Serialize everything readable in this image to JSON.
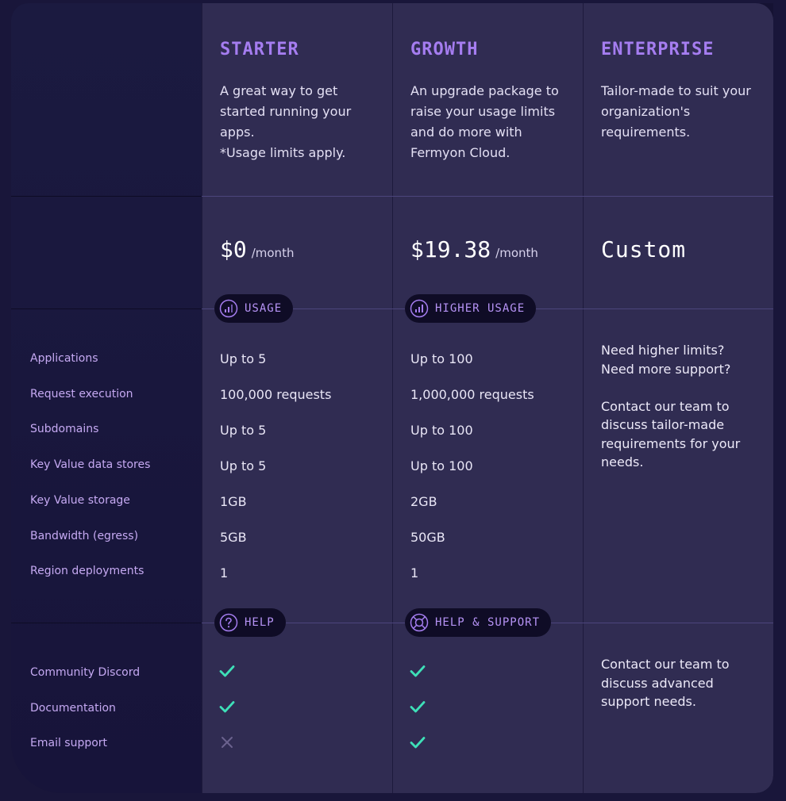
{
  "plans": [
    {
      "name": "STARTER",
      "description": "A great way to get started running your apps.\n*Usage limits apply.",
      "price": "$0",
      "price_unit": "/month",
      "usage_badge": "USAGE",
      "support_badge": "HELP",
      "values": [
        "Up to 5",
        "100,000 requests",
        "Up to 5",
        "Up to 5",
        "1GB",
        "5GB",
        "1"
      ],
      "support": [
        true,
        true,
        false
      ]
    },
    {
      "name": "GROWTH",
      "description": "An upgrade package to raise your usage limits and do more with Fermyon Cloud.",
      "price": "$19.38",
      "price_unit": "/month",
      "usage_badge": "HIGHER USAGE",
      "support_badge": "HELP & SUPPORT",
      "values": [
        "Up to 100",
        "1,000,000 requests",
        "Up to 100",
        "Up to 100",
        "2GB",
        "50GB",
        "1"
      ],
      "support": [
        true,
        true,
        true
      ]
    },
    {
      "name": "ENTERPRISE",
      "description": "Tailor-made to suit your organization's requirements.",
      "price": "Custom",
      "usage_note": "Need higher limits?\nNeed more support?\n\nContact our team to discuss tailor-made requirements for your needs.",
      "support_note": "Contact our team to discuss advanced support needs."
    }
  ],
  "usage_labels": [
    "Applications",
    "Request execution",
    "Subdomains",
    "Key Value data stores",
    "Key Value storage",
    "Bandwidth (egress)",
    "Region deployments"
  ],
  "support_labels": [
    "Community Discord",
    "Documentation",
    "Email support"
  ],
  "colors": {
    "accent": "#a57df0",
    "check": "#3ee0b8",
    "cross": "#6b628e",
    "plan_bg": "#302c52",
    "page_bg": "#19163a"
  },
  "icons": {
    "usage": "signal-bars-icon",
    "help": "question-circle-icon",
    "support": "lifebuoy-icon",
    "included": "check-icon",
    "excluded": "x-icon"
  }
}
